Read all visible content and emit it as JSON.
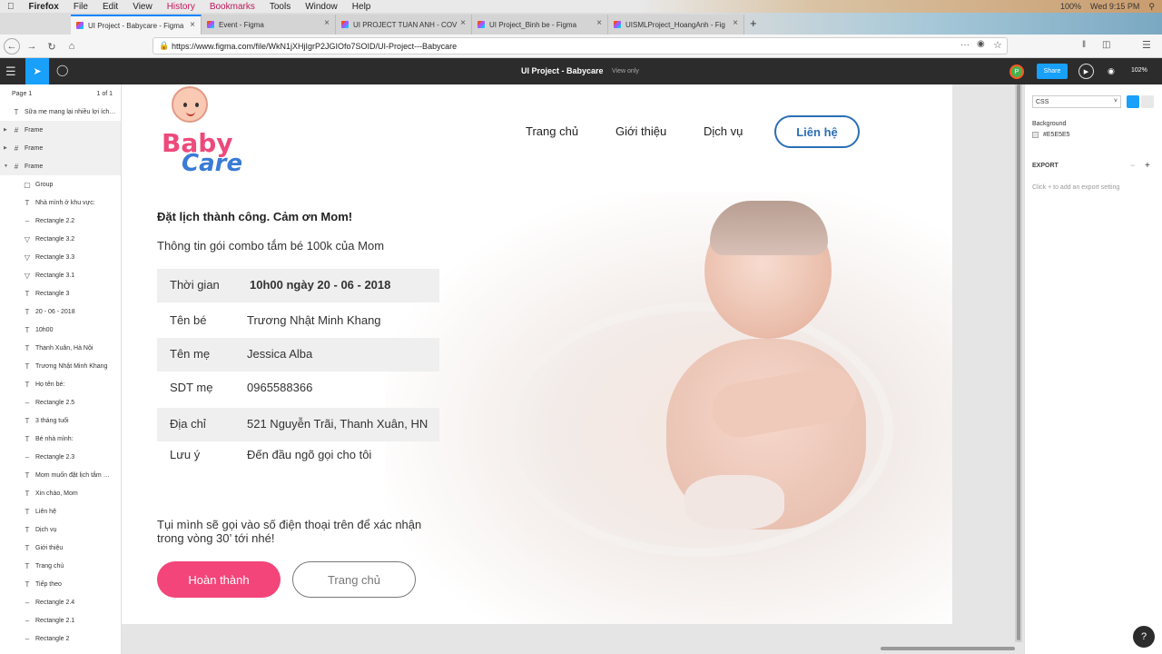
{
  "menubar": {
    "items": [
      "Firefox",
      "File",
      "Edit",
      "View",
      "History",
      "Bookmarks",
      "Tools",
      "Window",
      "Help"
    ],
    "battery": "100%",
    "clock": "Wed 9:15 PM"
  },
  "tabs": [
    {
      "label": "UI Project - Babycare - Figma"
    },
    {
      "label": "Event - Figma"
    },
    {
      "label": "UI PROJECT TUAN ANH - COV"
    },
    {
      "label": "UI Project_Binh be - Figma"
    },
    {
      "label": "UISMLProject_HoangAnh - Fig"
    }
  ],
  "url": "https://www.figma.com/file/WkN1jXHjIgrP2JGIOfo7SOID/UI-Project---Babycare",
  "figma": {
    "title": "UI Project - Babycare",
    "view_only": "View only",
    "avatar": "P",
    "share": "Share",
    "zoom": "102%"
  },
  "layers": {
    "page": "Page 1",
    "page_count": "1 of 1",
    "items": [
      {
        "icon": "T",
        "label": "Sữa mẹ mang lại nhiều lợi ích…",
        "indent": 0
      },
      {
        "icon": "#",
        "label": "Frame",
        "indent": 0
      },
      {
        "icon": "#",
        "label": "Frame",
        "indent": 0
      },
      {
        "icon": "#",
        "label": "Frame",
        "indent": 0
      },
      {
        "icon": "▢",
        "label": "Group",
        "indent": 1
      },
      {
        "icon": "T",
        "label": "Nhà mình ở khu vực:",
        "indent": 1
      },
      {
        "icon": "–",
        "label": "Rectangle 2.2",
        "indent": 1
      },
      {
        "icon": "▽",
        "label": "Rectangle 3.2",
        "indent": 1
      },
      {
        "icon": "▽",
        "label": "Rectangle 3.3",
        "indent": 1
      },
      {
        "icon": "▽",
        "label": "Rectangle 3.1",
        "indent": 1
      },
      {
        "icon": "T",
        "label": "Rectangle 3",
        "indent": 1
      },
      {
        "icon": "T",
        "label": "20 - 06 - 2018",
        "indent": 1
      },
      {
        "icon": "T",
        "label": "10h00",
        "indent": 1
      },
      {
        "icon": "T",
        "label": "Thanh Xuân, Hà Nội",
        "indent": 1
      },
      {
        "icon": "T",
        "label": "Trương Nhật Minh Khang",
        "indent": 1
      },
      {
        "icon": "T",
        "label": "Họ tên bé:",
        "indent": 1
      },
      {
        "icon": "–",
        "label": "Rectangle 2.5",
        "indent": 1
      },
      {
        "icon": "T",
        "label": "3 tháng tuổi",
        "indent": 1
      },
      {
        "icon": "T",
        "label": "Bé nhà mình:",
        "indent": 1
      },
      {
        "icon": "–",
        "label": "Rectangle 2.3",
        "indent": 1
      },
      {
        "icon": "T",
        "label": "Mom muốn đặt lịch tắm …",
        "indent": 1
      },
      {
        "icon": "T",
        "label": "Xin chào, Mom",
        "indent": 1
      },
      {
        "icon": "T",
        "label": "Liên hệ",
        "indent": 1
      },
      {
        "icon": "T",
        "label": "Dịch vụ",
        "indent": 1
      },
      {
        "icon": "T",
        "label": "Giới thiệu",
        "indent": 1
      },
      {
        "icon": "T",
        "label": "Trang chủ",
        "indent": 1
      },
      {
        "icon": "T",
        "label": "Tiếp theo",
        "indent": 1
      },
      {
        "icon": "–",
        "label": "Rectangle 2.4",
        "indent": 1
      },
      {
        "icon": "–",
        "label": "Rectangle 2.1",
        "indent": 1
      },
      {
        "icon": "–",
        "label": "Rectangle 2",
        "indent": 1
      }
    ]
  },
  "design": {
    "logo_line1": "Baby",
    "logo_line2": "Care",
    "nav": [
      "Trang chủ",
      "Giới thiệu",
      "Dịch vụ"
    ],
    "nav_contact": "Liên hệ",
    "heading": "Đặt lịch thành công. Cảm ơn Mom!",
    "subheading": "Thông tin gói combo tắm bé 100k của Mom",
    "rows": [
      {
        "k": "Thời gian",
        "v": "10h00 ngày 20 - 06 - 2018",
        "bold": true,
        "gray": true
      },
      {
        "k": "Tên bé",
        "v": "Trương Nhật Minh Khang",
        "bold": false,
        "gray": false
      },
      {
        "k": "Tên mẹ",
        "v": "Jessica Alba",
        "bold": false,
        "gray": true
      },
      {
        "k": "SDT mẹ",
        "v": "0965588366",
        "bold": false,
        "gray": false
      },
      {
        "k": "Địa chỉ",
        "v": "521 Nguyễn Trãi, Thanh Xuân, HN",
        "bold": false,
        "gray": true
      },
      {
        "k": "Lưu ý",
        "v": "Đến đầu ngõ gọi cho tôi",
        "bold": false,
        "gray": false
      }
    ],
    "note": "Tụi mình sẽ gọi vào số điện thoại trên để xác nhận trong vòng 30’ tới nhé!",
    "btn_done": "Hoàn thành",
    "btn_home": "Trang chủ"
  },
  "props": {
    "format": "CSS",
    "background_label": "Background",
    "background_value": "#E5E5E5",
    "export_label": "EXPORT",
    "export_hint": "Click + to add an export setting"
  },
  "colors": {
    "accent": "#18a0fb",
    "pink": "#f3457a",
    "blue": "#2a6fb5"
  }
}
